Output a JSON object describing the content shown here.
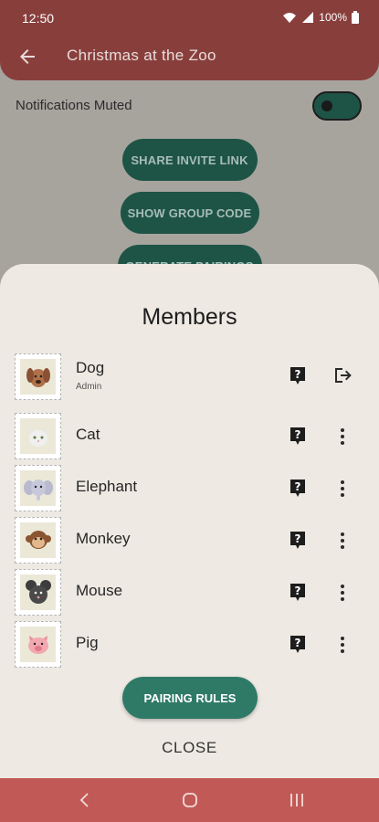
{
  "status_bar": {
    "time": "12:50",
    "battery": "100%"
  },
  "app_bar": {
    "title": "Christmas at the Zoo"
  },
  "settings": {
    "notifications_label": "Notifications Muted"
  },
  "background_buttons": {
    "share_invite": "SHARE INVITE LINK",
    "show_group_code": "SHOW GROUP CODE",
    "generate_pairings": "GENERATE PAIRINGS"
  },
  "sheet": {
    "title": "Members",
    "members": [
      {
        "name": "Dog",
        "role": "Admin",
        "action_icon": "exit-icon"
      },
      {
        "name": "Cat",
        "role": "",
        "action_icon": "more-vert-icon"
      },
      {
        "name": "Elephant",
        "role": "",
        "action_icon": "more-vert-icon"
      },
      {
        "name": "Monkey",
        "role": "",
        "action_icon": "more-vert-icon"
      },
      {
        "name": "Mouse",
        "role": "",
        "action_icon": "more-vert-icon"
      },
      {
        "name": "Pig",
        "role": "",
        "action_icon": "more-vert-icon"
      }
    ],
    "pairing_rules_label": "PAIRING RULES",
    "close_label": "CLOSE"
  },
  "colors": {
    "primary_red": "#883f3c",
    "accent_green": "#2f7a67",
    "sheet_bg": "#eee9e3",
    "nav_bar": "#c15a56"
  }
}
